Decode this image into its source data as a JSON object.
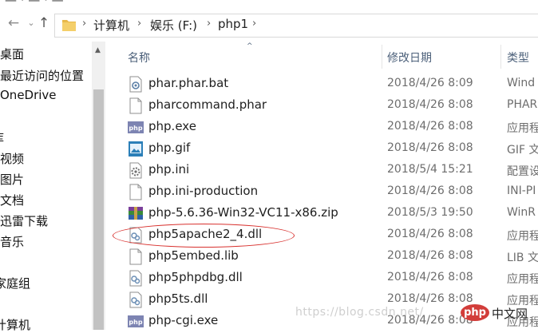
{
  "address_bar": {
    "crumbs": [
      "计算机",
      "娱乐 (F:)",
      "php1"
    ]
  },
  "nav_pane": {
    "items": [
      "桌面",
      "最近访问的位置",
      "OneDrive",
      "库",
      "视频",
      "图片",
      "文档",
      "迅雷下载",
      "音乐",
      "家庭组",
      "计算机"
    ]
  },
  "columns": {
    "name": "名称",
    "modified": "修改日期",
    "type": "类型"
  },
  "files": [
    {
      "name": "phar.phar.bat",
      "date": "2018/4/26 8:09",
      "type": "Wind",
      "icon": "batch-file-icon"
    },
    {
      "name": "pharcommand.phar",
      "date": "2018/4/26 8:08",
      "type": "PHAR",
      "icon": "blank-file-icon"
    },
    {
      "name": "php.exe",
      "date": "2018/4/26 8:08",
      "type": "应用程",
      "icon": "php-app-icon"
    },
    {
      "name": "php.gif",
      "date": "2018/4/26 8:08",
      "type": "GIF 文",
      "icon": "image-file-icon"
    },
    {
      "name": "php.ini",
      "date": "2018/5/4 15:21",
      "type": "配置设",
      "icon": "config-file-icon"
    },
    {
      "name": "php.ini-production",
      "date": "2018/4/26 8:08",
      "type": "INI-PI",
      "icon": "blank-file-icon"
    },
    {
      "name": "php-5.6.36-Win32-VC11-x86.zip",
      "date": "2018/5/3 19:50",
      "type": "WinR",
      "icon": "winrar-archive-icon"
    },
    {
      "name": "php5apache2_4.dll",
      "date": "2018/4/26 8:08",
      "type": "应用程",
      "icon": "dll-file-icon"
    },
    {
      "name": "php5embed.lib",
      "date": "2018/4/26 8:08",
      "type": "LIB 文",
      "icon": "blank-file-icon"
    },
    {
      "name": "php5phpdbg.dll",
      "date": "2018/4/26 8:08",
      "type": "应用程",
      "icon": "dll-file-icon"
    },
    {
      "name": "php5ts.dll",
      "date": "2018/4/26 8:08",
      "type": "应用程",
      "icon": "dll-file-icon"
    },
    {
      "name": "php-cgi.exe",
      "date": "2018/4/26 8:08",
      "type": "应用程",
      "icon": "php-app-icon"
    }
  ],
  "watermark": "https://blog.csdn.net/",
  "corner_logo": {
    "badge": "php",
    "text": "中文网"
  },
  "colors": {
    "annotation": "#d8312e",
    "header_text": "#4c607a"
  }
}
